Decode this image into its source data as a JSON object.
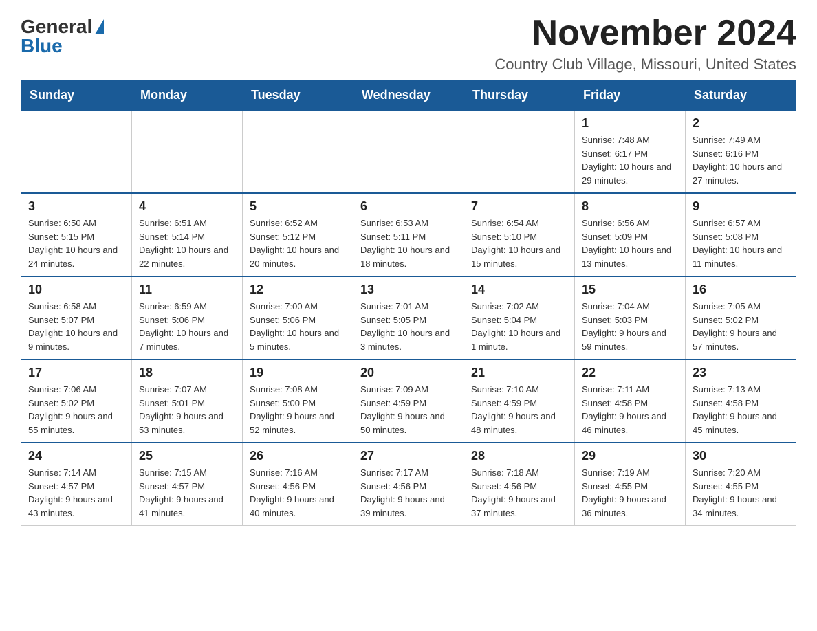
{
  "header": {
    "logo_general": "General",
    "logo_blue": "Blue",
    "month_title": "November 2024",
    "location": "Country Club Village, Missouri, United States"
  },
  "weekdays": [
    "Sunday",
    "Monday",
    "Tuesday",
    "Wednesday",
    "Thursday",
    "Friday",
    "Saturday"
  ],
  "weeks": [
    [
      {
        "day": "",
        "info": ""
      },
      {
        "day": "",
        "info": ""
      },
      {
        "day": "",
        "info": ""
      },
      {
        "day": "",
        "info": ""
      },
      {
        "day": "",
        "info": ""
      },
      {
        "day": "1",
        "info": "Sunrise: 7:48 AM\nSunset: 6:17 PM\nDaylight: 10 hours and 29 minutes."
      },
      {
        "day": "2",
        "info": "Sunrise: 7:49 AM\nSunset: 6:16 PM\nDaylight: 10 hours and 27 minutes."
      }
    ],
    [
      {
        "day": "3",
        "info": "Sunrise: 6:50 AM\nSunset: 5:15 PM\nDaylight: 10 hours and 24 minutes."
      },
      {
        "day": "4",
        "info": "Sunrise: 6:51 AM\nSunset: 5:14 PM\nDaylight: 10 hours and 22 minutes."
      },
      {
        "day": "5",
        "info": "Sunrise: 6:52 AM\nSunset: 5:12 PM\nDaylight: 10 hours and 20 minutes."
      },
      {
        "day": "6",
        "info": "Sunrise: 6:53 AM\nSunset: 5:11 PM\nDaylight: 10 hours and 18 minutes."
      },
      {
        "day": "7",
        "info": "Sunrise: 6:54 AM\nSunset: 5:10 PM\nDaylight: 10 hours and 15 minutes."
      },
      {
        "day": "8",
        "info": "Sunrise: 6:56 AM\nSunset: 5:09 PM\nDaylight: 10 hours and 13 minutes."
      },
      {
        "day": "9",
        "info": "Sunrise: 6:57 AM\nSunset: 5:08 PM\nDaylight: 10 hours and 11 minutes."
      }
    ],
    [
      {
        "day": "10",
        "info": "Sunrise: 6:58 AM\nSunset: 5:07 PM\nDaylight: 10 hours and 9 minutes."
      },
      {
        "day": "11",
        "info": "Sunrise: 6:59 AM\nSunset: 5:06 PM\nDaylight: 10 hours and 7 minutes."
      },
      {
        "day": "12",
        "info": "Sunrise: 7:00 AM\nSunset: 5:06 PM\nDaylight: 10 hours and 5 minutes."
      },
      {
        "day": "13",
        "info": "Sunrise: 7:01 AM\nSunset: 5:05 PM\nDaylight: 10 hours and 3 minutes."
      },
      {
        "day": "14",
        "info": "Sunrise: 7:02 AM\nSunset: 5:04 PM\nDaylight: 10 hours and 1 minute."
      },
      {
        "day": "15",
        "info": "Sunrise: 7:04 AM\nSunset: 5:03 PM\nDaylight: 9 hours and 59 minutes."
      },
      {
        "day": "16",
        "info": "Sunrise: 7:05 AM\nSunset: 5:02 PM\nDaylight: 9 hours and 57 minutes."
      }
    ],
    [
      {
        "day": "17",
        "info": "Sunrise: 7:06 AM\nSunset: 5:02 PM\nDaylight: 9 hours and 55 minutes."
      },
      {
        "day": "18",
        "info": "Sunrise: 7:07 AM\nSunset: 5:01 PM\nDaylight: 9 hours and 53 minutes."
      },
      {
        "day": "19",
        "info": "Sunrise: 7:08 AM\nSunset: 5:00 PM\nDaylight: 9 hours and 52 minutes."
      },
      {
        "day": "20",
        "info": "Sunrise: 7:09 AM\nSunset: 4:59 PM\nDaylight: 9 hours and 50 minutes."
      },
      {
        "day": "21",
        "info": "Sunrise: 7:10 AM\nSunset: 4:59 PM\nDaylight: 9 hours and 48 minutes."
      },
      {
        "day": "22",
        "info": "Sunrise: 7:11 AM\nSunset: 4:58 PM\nDaylight: 9 hours and 46 minutes."
      },
      {
        "day": "23",
        "info": "Sunrise: 7:13 AM\nSunset: 4:58 PM\nDaylight: 9 hours and 45 minutes."
      }
    ],
    [
      {
        "day": "24",
        "info": "Sunrise: 7:14 AM\nSunset: 4:57 PM\nDaylight: 9 hours and 43 minutes."
      },
      {
        "day": "25",
        "info": "Sunrise: 7:15 AM\nSunset: 4:57 PM\nDaylight: 9 hours and 41 minutes."
      },
      {
        "day": "26",
        "info": "Sunrise: 7:16 AM\nSunset: 4:56 PM\nDaylight: 9 hours and 40 minutes."
      },
      {
        "day": "27",
        "info": "Sunrise: 7:17 AM\nSunset: 4:56 PM\nDaylight: 9 hours and 39 minutes."
      },
      {
        "day": "28",
        "info": "Sunrise: 7:18 AM\nSunset: 4:56 PM\nDaylight: 9 hours and 37 minutes."
      },
      {
        "day": "29",
        "info": "Sunrise: 7:19 AM\nSunset: 4:55 PM\nDaylight: 9 hours and 36 minutes."
      },
      {
        "day": "30",
        "info": "Sunrise: 7:20 AM\nSunset: 4:55 PM\nDaylight: 9 hours and 34 minutes."
      }
    ]
  ]
}
